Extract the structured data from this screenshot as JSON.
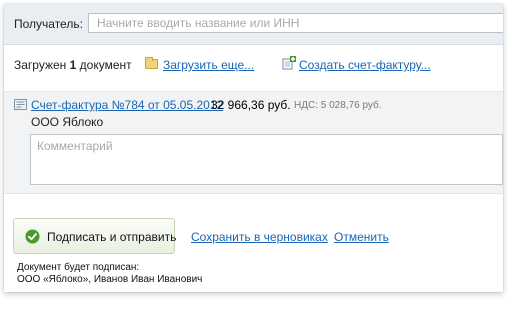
{
  "recipient": {
    "label": "Получатель:",
    "placeholder": "Начните вводить название или ИНН",
    "value": ""
  },
  "status": {
    "prefix": "Загружен ",
    "count": "1",
    "suffix": " документ",
    "upload_more_label": "Загрузить еще...",
    "create_invoice_label": "Создать счет-фактуру..."
  },
  "invoice": {
    "title": "Счет-фактура №784 от 05.05.2012",
    "amount": "32 966,36 руб.",
    "vat": "НДС: 5 028,76 руб.",
    "company": "ООО Яблоко",
    "comment_placeholder": "Комментарий",
    "comment_value": ""
  },
  "actions": {
    "sign_send_label": "Подписать и отправить",
    "save_drafts_label": "Сохранить в черновиках",
    "cancel_label": "Отменить"
  },
  "signature_note": {
    "line1": "Документ будет подписан:",
    "line2": "ООО «Яблоко», Иванов Иван Иванович"
  },
  "colors": {
    "link": "#1a66b5",
    "accent_green": "#4a9a2e",
    "header_bg": "#eaeef2"
  },
  "icons": {
    "folder": "folder-icon",
    "create_doc": "doc-plus-icon",
    "invoice": "invoice-doc-icon",
    "sign": "check-circle-icon"
  }
}
